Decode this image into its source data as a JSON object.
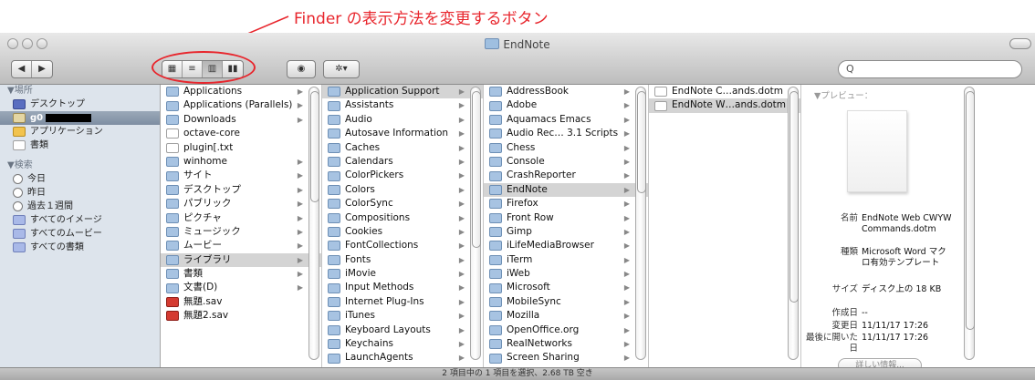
{
  "annotation": {
    "text": "Finder の表示方法を変更するボタン",
    "color": "#e8262d"
  },
  "window": {
    "title": "EndNote"
  },
  "toolbar": {
    "back_icon": "chevron-left-icon",
    "forward_icon": "chevron-right-icon",
    "view_modes": [
      {
        "name": "icon-view",
        "glyph": "▦"
      },
      {
        "name": "list-view",
        "glyph": "≡"
      },
      {
        "name": "column-view",
        "glyph": "▥",
        "active": true
      },
      {
        "name": "coverflow-view",
        "glyph": "▮▮"
      }
    ],
    "quicklook_glyph": "◉",
    "action_glyph": "✲▾",
    "search_glyph": "Q",
    "search_placeholder": ""
  },
  "sidebar": {
    "places_header": "▼場所",
    "places": [
      {
        "label": "デスクトップ",
        "icon": "desktop-icon"
      },
      {
        "label": "g0",
        "icon": "home-icon",
        "selected": true
      },
      {
        "label": "アプリケーション",
        "icon": "applications-icon"
      },
      {
        "label": "書類",
        "icon": "documents-icon"
      }
    ],
    "search_header": "▼検索",
    "searches": [
      {
        "label": "今日",
        "icon": "clock-icon"
      },
      {
        "label": "昨日",
        "icon": "clock-icon"
      },
      {
        "label": "過去１週間",
        "icon": "clock-icon"
      },
      {
        "label": "すべてのイメージ",
        "icon": "smart-folder-icon"
      },
      {
        "label": "すべてのムービー",
        "icon": "smart-folder-icon"
      },
      {
        "label": "すべての書類",
        "icon": "smart-folder-icon"
      }
    ]
  },
  "columns": [
    {
      "items": [
        {
          "label": "Applications",
          "icon": "folder",
          "arrow": true
        },
        {
          "label": "Applications (Parallels)",
          "icon": "folder",
          "arrow": true
        },
        {
          "label": "Downloads",
          "icon": "folder",
          "arrow": true
        },
        {
          "label": "octave-core",
          "icon": "doc"
        },
        {
          "label": "plugin[.txt",
          "icon": "doc"
        },
        {
          "label": "winhome",
          "icon": "folder",
          "arrow": true
        },
        {
          "label": "サイト",
          "icon": "folder",
          "arrow": true
        },
        {
          "label": "デスクトップ",
          "icon": "folder",
          "arrow": true
        },
        {
          "label": "パブリック",
          "icon": "folder",
          "arrow": true
        },
        {
          "label": "ピクチャ",
          "icon": "folder",
          "arrow": true
        },
        {
          "label": "ミュージック",
          "icon": "folder",
          "arrow": true
        },
        {
          "label": "ムービー",
          "icon": "folder",
          "arrow": true
        },
        {
          "label": "ライブラリ",
          "icon": "folder",
          "arrow": true,
          "selected": true
        },
        {
          "label": "書類",
          "icon": "folder",
          "arrow": true
        },
        {
          "label": "文書(D)",
          "icon": "folder",
          "arrow": true
        },
        {
          "label": "無題.sav",
          "icon": "red"
        },
        {
          "label": "無題2.sav",
          "icon": "red"
        }
      ]
    },
    {
      "items": [
        {
          "label": "Application Support",
          "icon": "folder",
          "arrow": true,
          "selected": true
        },
        {
          "label": "Assistants",
          "icon": "folder",
          "arrow": true
        },
        {
          "label": "Audio",
          "icon": "folder",
          "arrow": true
        },
        {
          "label": "Autosave Information",
          "icon": "folder",
          "arrow": true
        },
        {
          "label": "Caches",
          "icon": "folder",
          "arrow": true
        },
        {
          "label": "Calendars",
          "icon": "folder",
          "arrow": true
        },
        {
          "label": "ColorPickers",
          "icon": "folder",
          "arrow": true
        },
        {
          "label": "Colors",
          "icon": "folder",
          "arrow": true
        },
        {
          "label": "ColorSync",
          "icon": "folder",
          "arrow": true
        },
        {
          "label": "Compositions",
          "icon": "folder",
          "arrow": true
        },
        {
          "label": "Cookies",
          "icon": "folder",
          "arrow": true
        },
        {
          "label": "FontCollections",
          "icon": "folder",
          "arrow": true
        },
        {
          "label": "Fonts",
          "icon": "folder",
          "arrow": true
        },
        {
          "label": "iMovie",
          "icon": "folder",
          "arrow": true
        },
        {
          "label": "Input Methods",
          "icon": "folder",
          "arrow": true
        },
        {
          "label": "Internet Plug-Ins",
          "icon": "folder",
          "arrow": true
        },
        {
          "label": "iTunes",
          "icon": "folder",
          "arrow": true
        },
        {
          "label": "Keyboard Layouts",
          "icon": "folder",
          "arrow": true
        },
        {
          "label": "Keychains",
          "icon": "folder",
          "arrow": true
        },
        {
          "label": "LaunchAgents",
          "icon": "folder",
          "arrow": true
        }
      ]
    },
    {
      "items": [
        {
          "label": "AddressBook",
          "icon": "folder",
          "arrow": true
        },
        {
          "label": "Adobe",
          "icon": "folder",
          "arrow": true
        },
        {
          "label": "Aquamacs Emacs",
          "icon": "folder",
          "arrow": true
        },
        {
          "label": "Audio Rec… 3.1 Scripts",
          "icon": "folder",
          "arrow": true
        },
        {
          "label": "Chess",
          "icon": "folder",
          "arrow": true
        },
        {
          "label": "Console",
          "icon": "folder",
          "arrow": true
        },
        {
          "label": "CrashReporter",
          "icon": "folder",
          "arrow": true
        },
        {
          "label": "EndNote",
          "icon": "folder",
          "arrow": true,
          "selected": true
        },
        {
          "label": "Firefox",
          "icon": "folder",
          "arrow": true
        },
        {
          "label": "Front Row",
          "icon": "folder",
          "arrow": true
        },
        {
          "label": "Gimp",
          "icon": "folder",
          "arrow": true
        },
        {
          "label": "iLifeMediaBrowser",
          "icon": "folder",
          "arrow": true
        },
        {
          "label": "iTerm",
          "icon": "folder",
          "arrow": true
        },
        {
          "label": "iWeb",
          "icon": "folder",
          "arrow": true
        },
        {
          "label": "Microsoft",
          "icon": "folder",
          "arrow": true
        },
        {
          "label": "MobileSync",
          "icon": "folder",
          "arrow": true
        },
        {
          "label": "Mozilla",
          "icon": "folder",
          "arrow": true
        },
        {
          "label": "OpenOffice.org",
          "icon": "folder",
          "arrow": true
        },
        {
          "label": "RealNetworks",
          "icon": "folder",
          "arrow": true
        },
        {
          "label": "Screen Sharing",
          "icon": "folder",
          "arrow": true
        }
      ]
    },
    {
      "items": [
        {
          "label": "EndNote C…ands.dotm",
          "icon": "doc"
        },
        {
          "label": "EndNote W…ands.dotm",
          "icon": "doc",
          "selected": true
        }
      ]
    }
  ],
  "preview": {
    "header": "▼プレビュー：",
    "meta": [
      {
        "key": "名前",
        "value": "EndNote Web CWYW Commands.dotm"
      },
      {
        "key": "種類",
        "value": "Microsoft Word マクロ有効テンプレート"
      },
      {
        "key": "サイズ",
        "value": "ディスク上の 18 KB"
      },
      {
        "key": "作成日",
        "value": "--"
      },
      {
        "key": "変更日",
        "value": "11/11/17 17:26"
      },
      {
        "key": "最後に開いた日",
        "value": "11/11/17 17:26"
      }
    ],
    "more_button": "詳しい情報..."
  },
  "status": "2 項目中の 1 項目を選択、2.68 TB 空き"
}
